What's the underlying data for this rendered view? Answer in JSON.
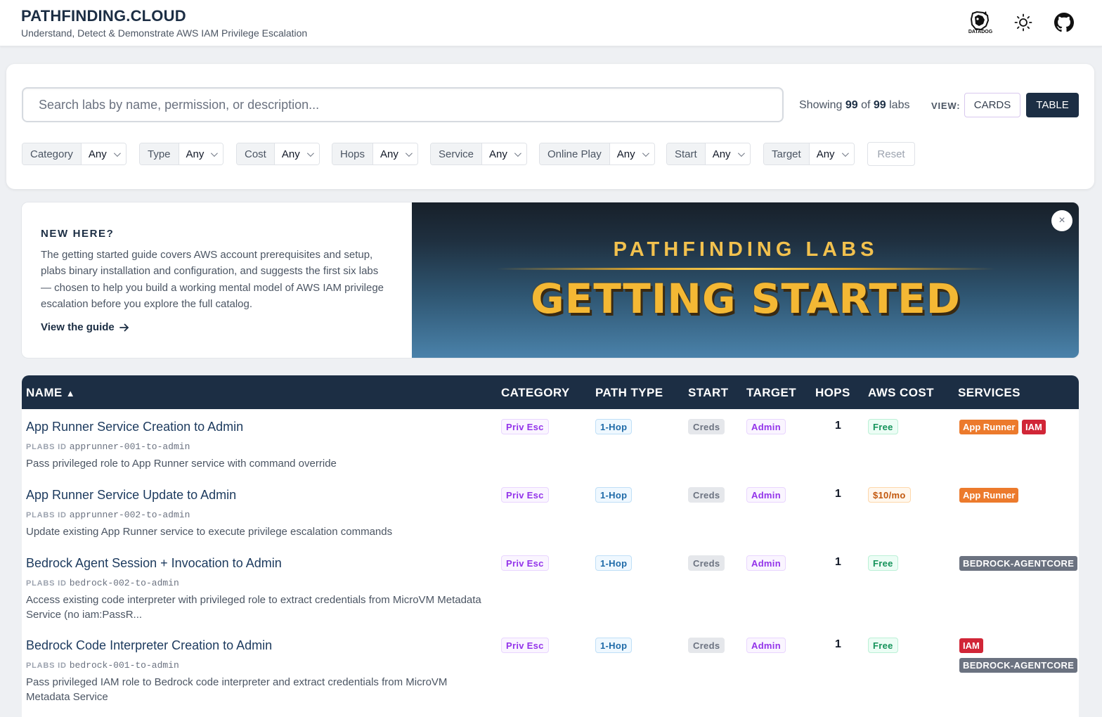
{
  "header": {
    "title": "PATHFINDING.CLOUD",
    "subtitle": "Understand, Detect & Demonstrate AWS IAM Privilege Escalation",
    "datadog_label": "DATADOG"
  },
  "search": {
    "placeholder": "Search labs by name, permission, or description...",
    "value": ""
  },
  "results": {
    "prefix": "Showing",
    "shown": "99",
    "of": "of",
    "total": "99",
    "suffix": "labs"
  },
  "view": {
    "label": "VIEW:",
    "cards": "CARDS",
    "table": "TABLE",
    "active": "table"
  },
  "filters": [
    {
      "label": "Category",
      "value": "Any"
    },
    {
      "label": "Type",
      "value": "Any"
    },
    {
      "label": "Cost",
      "value": "Any"
    },
    {
      "label": "Hops",
      "value": "Any"
    },
    {
      "label": "Service",
      "value": "Any"
    },
    {
      "label": "Online Play",
      "value": "Any"
    },
    {
      "label": "Start",
      "value": "Any"
    },
    {
      "label": "Target",
      "value": "Any"
    }
  ],
  "reset_label": "Reset",
  "banner": {
    "heading": "NEW HERE?",
    "text": "The getting started guide covers AWS account prerequisites and setup, plabs binary installation and configuration, and suggests the first six labs — chosen to help you build a working mental model of AWS IAM privilege escalation before you explore the full catalog.",
    "link": "View the guide",
    "image_kicker": "PATHFINDING LABS",
    "image_title": "GETTING STARTED",
    "close": "×"
  },
  "table": {
    "columns": {
      "name": "NAME",
      "sort_indicator": "▲",
      "category": "CATEGORY",
      "path_type": "PATH TYPE",
      "start": "START",
      "target": "TARGET",
      "hops": "HOPS",
      "aws_cost": "AWS COST",
      "services": "SERVICES"
    },
    "id_label": "PLABS ID",
    "rows": [
      {
        "name": "App Runner Service Creation to Admin",
        "id": "apprunner-001-to-admin",
        "description": "Pass privileged role to App Runner service with command override",
        "category": "Priv Esc",
        "path_type": "1-Hop",
        "start": "Creds",
        "target": "Admin",
        "hops": "1",
        "cost": "Free",
        "services": [
          "App Runner",
          "IAM"
        ]
      },
      {
        "name": "App Runner Service Update to Admin",
        "id": "apprunner-002-to-admin",
        "description": "Update existing App Runner service to execute privilege escalation commands",
        "category": "Priv Esc",
        "path_type": "1-Hop",
        "start": "Creds",
        "target": "Admin",
        "hops": "1",
        "cost": "$10/mo",
        "services": [
          "App Runner"
        ]
      },
      {
        "name": "Bedrock Agent Session + Invocation to Admin",
        "id": "bedrock-002-to-admin",
        "description": "Access existing code interpreter with privileged role to extract credentials from MicroVM Metadata Service (no iam:PassR...",
        "category": "Priv Esc",
        "path_type": "1-Hop",
        "start": "Creds",
        "target": "Admin",
        "hops": "1",
        "cost": "Free",
        "services": [
          "BEDROCK-AGENTCORE"
        ]
      },
      {
        "name": "Bedrock Code Interpreter Creation to Admin",
        "id": "bedrock-001-to-admin",
        "description": "Pass privileged IAM role to Bedrock code interpreter and extract credentials from MicroVM Metadata Service",
        "category": "Priv Esc",
        "path_type": "1-Hop",
        "start": "Creds",
        "target": "Admin",
        "hops": "1",
        "cost": "Free",
        "services": [
          "IAM",
          "BEDROCK-AGENTCORE"
        ]
      }
    ]
  }
}
